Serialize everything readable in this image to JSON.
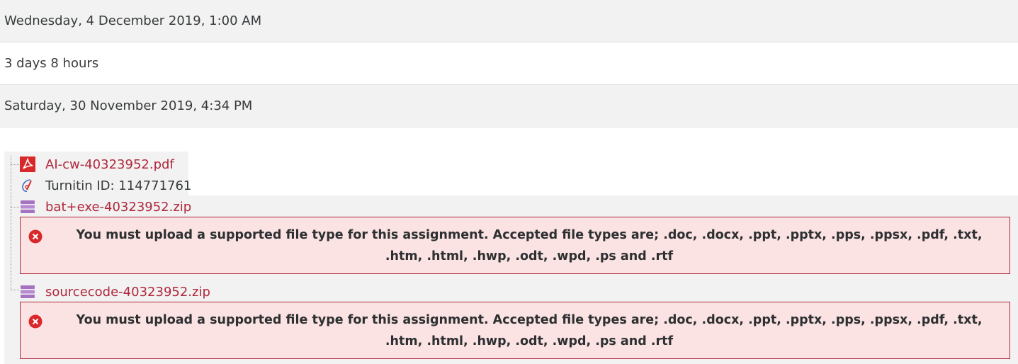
{
  "rows": [
    {
      "text": "Wednesday, 4 December 2019, 1:00 AM"
    },
    {
      "text": "3 days 8 hours"
    },
    {
      "text": "Saturday, 30 November 2019, 4:34 PM"
    }
  ],
  "files": [
    {
      "name": "AI-cw-40323952.pdf",
      "icon": "pdf-icon"
    },
    {
      "name": "Turnitin ID: 114771761",
      "icon": "turnitin-icon"
    },
    {
      "name": "bat+exe-40323952.zip",
      "icon": "archive-icon"
    },
    {
      "name": "sourcecode-40323952.zip",
      "icon": "archive-icon"
    }
  ],
  "alerts": [
    {
      "message": "You must upload a supported file type for this assignment. Accepted file types are; .doc, .docx, .ppt, .pptx, .pps, .ppsx, .pdf, .txt, .htm, .html, .hwp, .odt, .wpd, .ps and .rtf",
      "icon": "error-icon"
    },
    {
      "message": "You must upload a supported file type for this assignment. Accepted file types are; .doc, .docx, .ppt, .pptx, .pps, .ppsx, .pdf, .txt, .htm, .html, .hwp, .odt, .wpd, .ps and .rtf",
      "icon": "error-icon"
    }
  ],
  "colors": {
    "link": "#b0283c",
    "alert_bg": "#fbe3e4",
    "alert_border": "#b0283c",
    "row_grey": "#f2f2f2"
  }
}
